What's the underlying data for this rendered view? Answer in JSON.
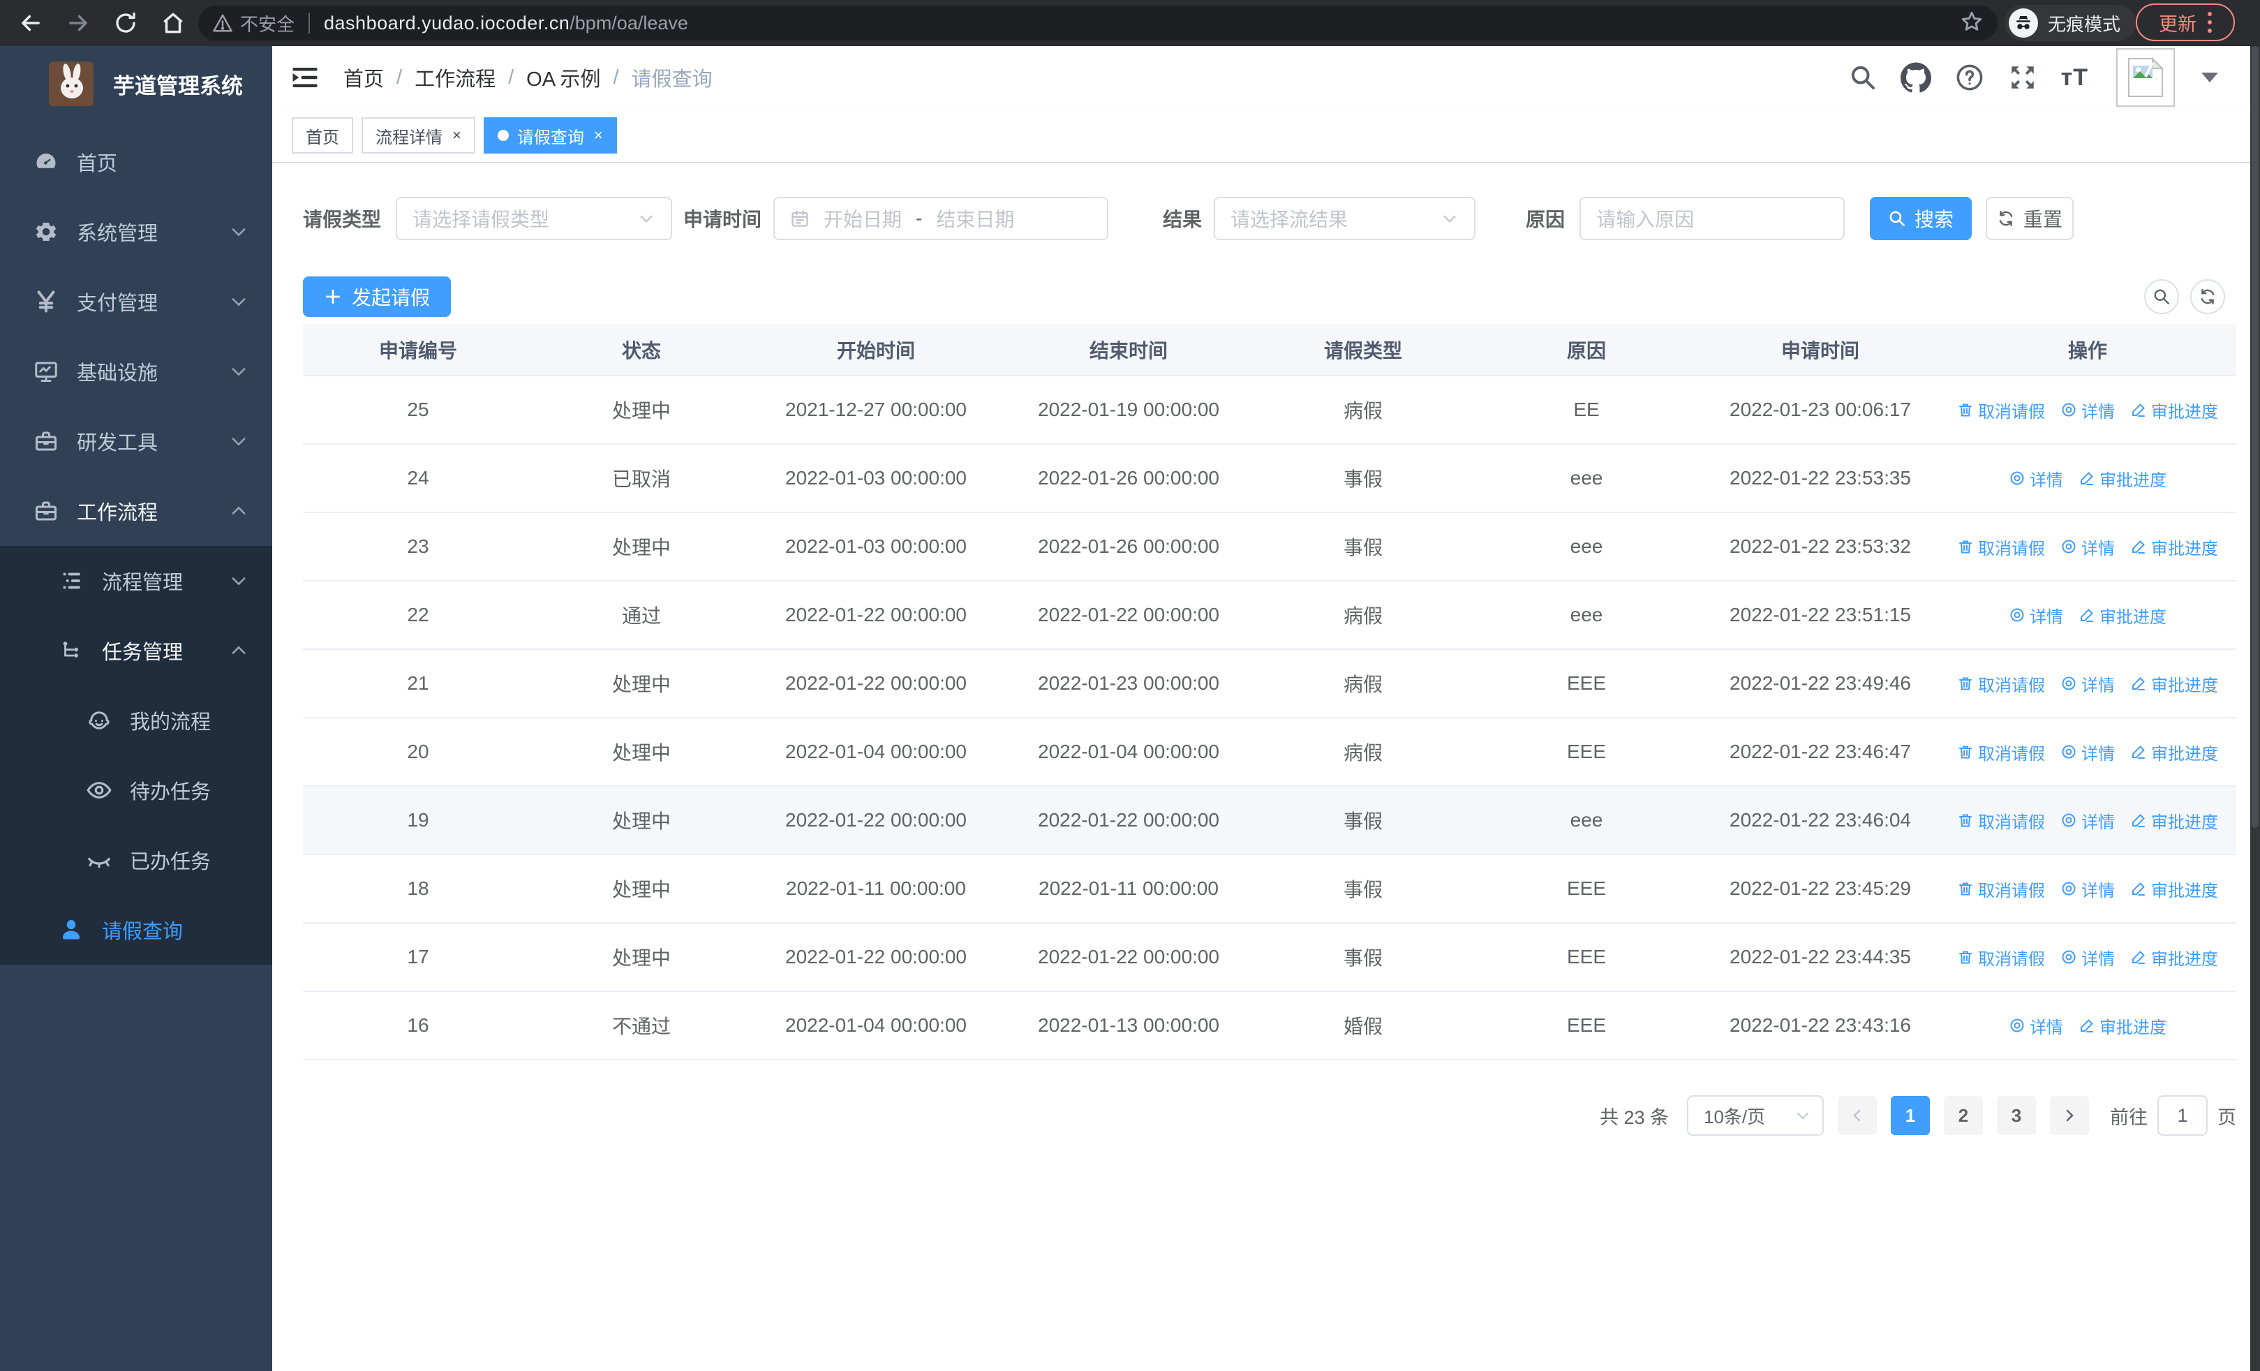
{
  "browser": {
    "security_label": "不安全",
    "url_domain": "dashboard.yudao.iocoder.cn",
    "url_path": "/bpm/oa/leave",
    "incognito_label": "无痕模式",
    "update_label": "更新"
  },
  "sidebar": {
    "app_title": "芋道管理系统",
    "menu": [
      {
        "label": "首页",
        "icon": "dashboard-icon"
      },
      {
        "label": "系统管理",
        "icon": "gear-icon",
        "chevron": "down"
      },
      {
        "label": "支付管理",
        "icon": "yen-icon",
        "chevron": "down"
      },
      {
        "label": "基础设施",
        "icon": "monitor-icon",
        "chevron": "down"
      },
      {
        "label": "研发工具",
        "icon": "toolbox-icon",
        "chevron": "down"
      },
      {
        "label": "工作流程",
        "icon": "briefcase-icon",
        "chevron": "up",
        "open": true,
        "children": [
          {
            "label": "流程管理",
            "icon": "list-icon",
            "chevron": "down"
          },
          {
            "label": "任务管理",
            "icon": "tree-icon",
            "chevron": "up",
            "open": true,
            "children": [
              {
                "label": "我的流程",
                "icon": "face-icon"
              },
              {
                "label": "待办任务",
                "icon": "eye-icon"
              },
              {
                "label": "已办任务",
                "icon": "eye-closed-icon"
              }
            ]
          },
          {
            "label": "请假查询",
            "icon": "user-icon",
            "active": true
          }
        ]
      }
    ]
  },
  "navbar": {
    "breadcrumb": [
      "首页",
      "工作流程",
      "OA 示例",
      "请假查询"
    ]
  },
  "tabs": [
    {
      "label": "首页",
      "active": false,
      "closable": false
    },
    {
      "label": "流程详情",
      "active": false,
      "closable": true
    },
    {
      "label": "请假查询",
      "active": true,
      "closable": true
    }
  ],
  "filters": {
    "type_label": "请假类型",
    "type_placeholder": "请选择请假类型",
    "time_label": "申请时间",
    "time_start_placeholder": "开始日期",
    "time_separator": "-",
    "time_end_placeholder": "结束日期",
    "result_label": "结果",
    "result_placeholder": "请选择流结果",
    "reason_label": "原因",
    "reason_placeholder": "请输入原因",
    "search_label": "搜索",
    "reset_label": "重置"
  },
  "toolbar": {
    "create_label": "发起请假"
  },
  "table": {
    "columns": [
      "申请编号",
      "状态",
      "开始时间",
      "结束时间",
      "请假类型",
      "原因",
      "申请时间",
      "操作"
    ],
    "action_labels": {
      "cancel": "取消请假",
      "detail": "详情",
      "progress": "审批进度"
    },
    "rows": [
      {
        "id": "25",
        "status": "处理中",
        "start": "2021-12-27 00:00:00",
        "end": "2022-01-19 00:00:00",
        "type": "病假",
        "reason": "EE",
        "applied": "2022-01-23 00:06:17",
        "can_cancel": true,
        "highlighted": false
      },
      {
        "id": "24",
        "status": "已取消",
        "start": "2022-01-03 00:00:00",
        "end": "2022-01-26 00:00:00",
        "type": "事假",
        "reason": "eee",
        "applied": "2022-01-22 23:53:35",
        "can_cancel": false,
        "highlighted": false
      },
      {
        "id": "23",
        "status": "处理中",
        "start": "2022-01-03 00:00:00",
        "end": "2022-01-26 00:00:00",
        "type": "事假",
        "reason": "eee",
        "applied": "2022-01-22 23:53:32",
        "can_cancel": true,
        "highlighted": false
      },
      {
        "id": "22",
        "status": "通过",
        "start": "2022-01-22 00:00:00",
        "end": "2022-01-22 00:00:00",
        "type": "病假",
        "reason": "eee",
        "applied": "2022-01-22 23:51:15",
        "can_cancel": false,
        "highlighted": false
      },
      {
        "id": "21",
        "status": "处理中",
        "start": "2022-01-22 00:00:00",
        "end": "2022-01-23 00:00:00",
        "type": "病假",
        "reason": "EEE",
        "applied": "2022-01-22 23:49:46",
        "can_cancel": true,
        "highlighted": false
      },
      {
        "id": "20",
        "status": "处理中",
        "start": "2022-01-04 00:00:00",
        "end": "2022-01-04 00:00:00",
        "type": "病假",
        "reason": "EEE",
        "applied": "2022-01-22 23:46:47",
        "can_cancel": true,
        "highlighted": false
      },
      {
        "id": "19",
        "status": "处理中",
        "start": "2022-01-22 00:00:00",
        "end": "2022-01-22 00:00:00",
        "type": "事假",
        "reason": "eee",
        "applied": "2022-01-22 23:46:04",
        "can_cancel": true,
        "highlighted": true
      },
      {
        "id": "18",
        "status": "处理中",
        "start": "2022-01-11 00:00:00",
        "end": "2022-01-11 00:00:00",
        "type": "事假",
        "reason": "EEE",
        "applied": "2022-01-22 23:45:29",
        "can_cancel": true,
        "highlighted": false
      },
      {
        "id": "17",
        "status": "处理中",
        "start": "2022-01-22 00:00:00",
        "end": "2022-01-22 00:00:00",
        "type": "事假",
        "reason": "EEE",
        "applied": "2022-01-22 23:44:35",
        "can_cancel": true,
        "highlighted": false
      },
      {
        "id": "16",
        "status": "不通过",
        "start": "2022-01-04 00:00:00",
        "end": "2022-01-13 00:00:00",
        "type": "婚假",
        "reason": "EEE",
        "applied": "2022-01-22 23:43:16",
        "can_cancel": false,
        "highlighted": false
      }
    ]
  },
  "pagination": {
    "total_text": "共 23 条",
    "page_size": "10条/页",
    "pages": [
      "1",
      "2",
      "3"
    ],
    "active_page": "1",
    "jump_prefix": "前往",
    "jump_value": "1",
    "jump_suffix": "页"
  },
  "colors": {
    "primary": "#409EFF",
    "sidebar": "#304156",
    "submenu": "#1f2d3d"
  }
}
